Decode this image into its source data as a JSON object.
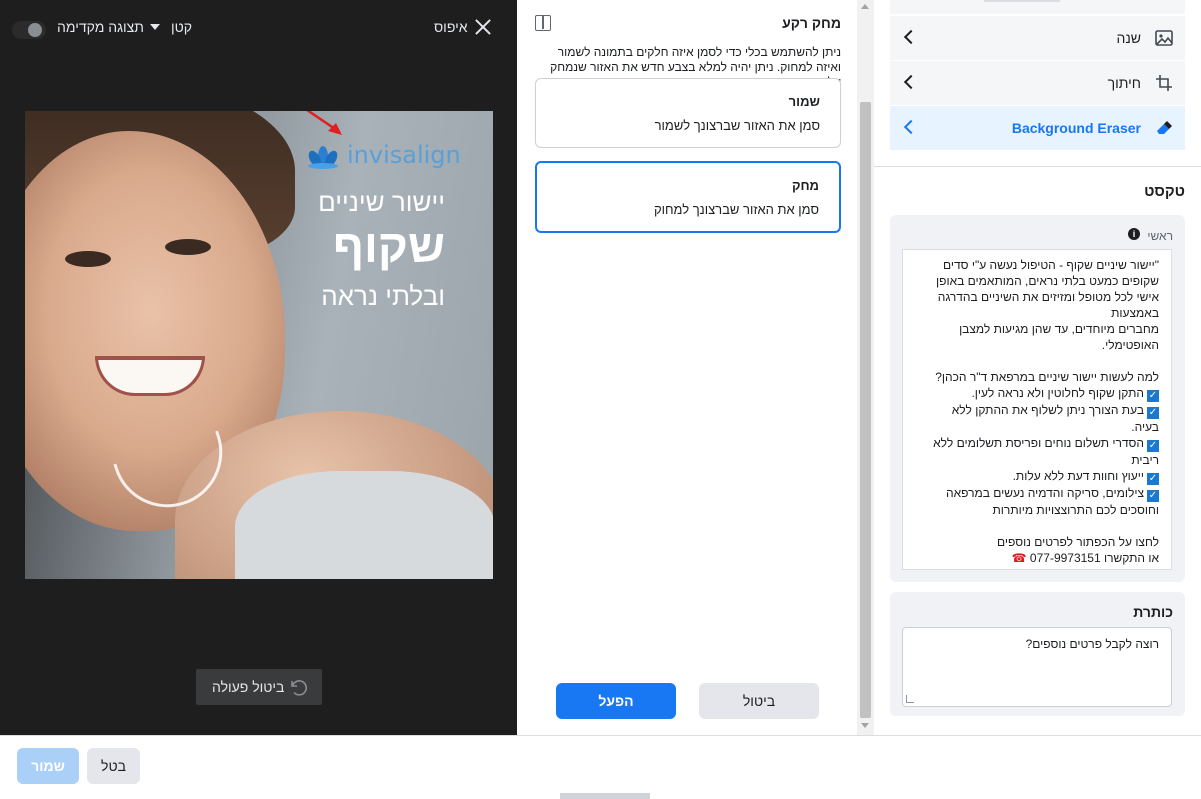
{
  "preview": {
    "reset_label": "איפוס",
    "size_label": "קטן",
    "preview_label": "תצוגה מקדימה",
    "undo_label": "ביטול פעולה",
    "ad": {
      "brand": "invisalign",
      "line1": "יישור שיניים",
      "line2": "שקוף",
      "line3": "ובלתי נראה"
    }
  },
  "eraser": {
    "title": "מחק רקע",
    "description": "ניתן להשתמש בכלי כדי לסמן איזה חלקים בתמונה לשמור ואיזה למחוק. ניתן יהיה למלא בצבע חדש את האזור שנמחק על ידך.",
    "keep": {
      "title": "שמור",
      "text": "סמן את האזור שברצונך לשמור"
    },
    "erase": {
      "title": "מחק",
      "text": "סמן את האזור שברצונך למחוק"
    },
    "cancel_label": "ביטול",
    "apply_label": "הפעל"
  },
  "tools": {
    "items": [
      {
        "label": "שנה",
        "icon": "image-icon"
      },
      {
        "label": "חיתוך",
        "icon": "crop-icon"
      },
      {
        "label": "Background Eraser",
        "icon": "eraser-icon",
        "active": true
      }
    ]
  },
  "text_section": {
    "title": "טקסט",
    "primary_label": "ראשי",
    "primary_lines": [
      "\"יישור שיניים שקוף - הטיפול נעשה ע\"י סדים",
      "שקופים כמעט בלתי נראים, המותאמים באופן",
      "אישי לכל מטופל ומזיזים את השיניים בהדרגה",
      "באמצעות",
      "מחברים מיוחדים, עד שהן מגיעות למצבן",
      "האופטימלי.",
      "",
      "למה לעשות יישור שיניים במרפאת ד\"ר הכהן?",
      "התקן שקוף לחלוטין ולא נראה לעין.",
      "בעת הצורך ניתן לשלוף את ההתקן ללא",
      "בעיה.",
      "הסדרי תשלום נוחים ופריסת תשלומים ללא",
      "ריבית",
      "ייעוץ וחוות דעת ללא עלות.",
      "צילומים, סריקה והדמיה נעשים במרפאה",
      "וחוסכים לכם התרוצצויות מיותרות",
      "",
      "לחצו על הכפתור לפרטים נוספים",
      "או התקשרו 077-9973151"
    ],
    "headline_label": "כותרת",
    "headline_value": "רוצה לקבל פרטים נוספים?"
  },
  "bottom": {
    "save_label": "שמור",
    "cancel_label": "בטל"
  },
  "colors": {
    "accent": "#1877f2",
    "checkbox": "#1b78d0",
    "dark_bg": "#1e1e1e"
  }
}
